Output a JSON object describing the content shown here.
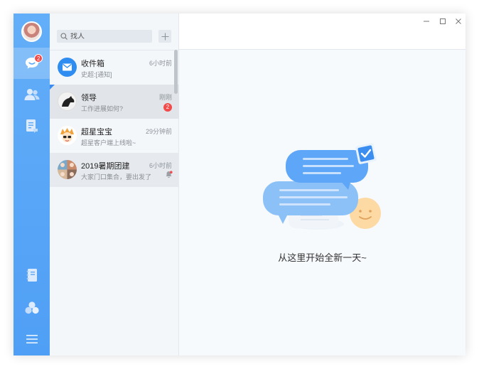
{
  "search": {
    "placeholder": "找人"
  },
  "sidebar": {
    "chat_badge": "2",
    "items": [
      "chat-icon",
      "contacts-icon",
      "document-icon",
      "notebook-icon",
      "apps-icon",
      "menu-icon"
    ]
  },
  "conversations": [
    {
      "name": "收件箱",
      "time": "6小时前",
      "preview": "史超:[通知]",
      "unread": ""
    },
    {
      "name": "领导",
      "time": "刚刚",
      "preview": "工作进展如何?",
      "unread": "2"
    },
    {
      "name": "超星宝宝",
      "time": "29分钟前",
      "preview": "超星客户端上线啦~",
      "unread": ""
    },
    {
      "name": "2019暑期团建",
      "time": "6小时前",
      "preview": "大家门口集合，要出发了",
      "unread": ""
    }
  ],
  "main": {
    "empty_message": "从这里开始全新一天~"
  },
  "colors": {
    "sidebar": "#5aa8f7",
    "badge": "#f24b4b",
    "accent": "#3b8ef0"
  }
}
